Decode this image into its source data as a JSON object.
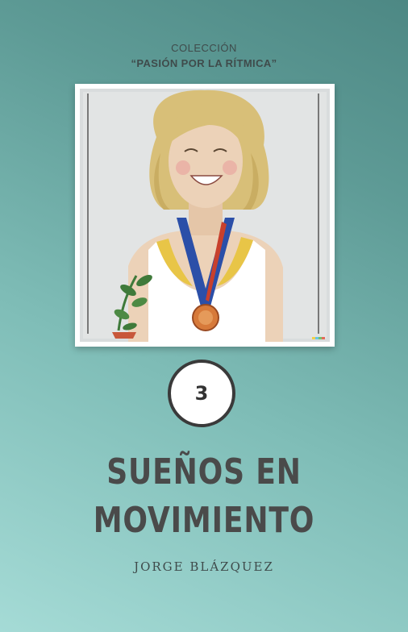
{
  "cover": {
    "series_label": "COLECCIÓN",
    "series_name": "“PASIÓN POR LA RÍTMICA”",
    "volume_number": "3",
    "title_line1": "SUEÑOS EN",
    "title_line2": "MOVIMIENTO",
    "author": "JORGE BLÁZQUEZ"
  },
  "illustration": {
    "subject": "smiling-girl-with-medal",
    "colors": {
      "background": "#d9dcdd",
      "hair": "#d8bf78",
      "skin": "#ecd2b8",
      "ribbon_blue": "#2b4fa8",
      "ribbon_red": "#c8402c",
      "medal": "#d77a3a",
      "leotard_yellow": "#e8c547",
      "leaves": "#3f7a3a"
    }
  }
}
